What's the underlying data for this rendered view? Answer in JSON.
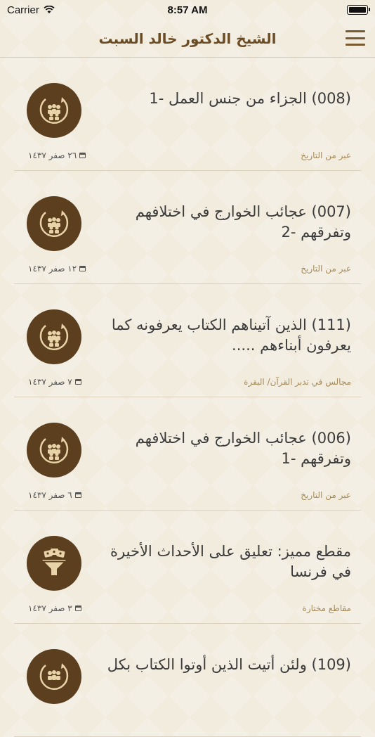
{
  "status": {
    "carrier": "Carrier",
    "time": "8:57 AM"
  },
  "header": {
    "title": "الشيخ الدكتور خالد السبت"
  },
  "items": [
    {
      "title": "(008) الجزاء من جنس العمل -1",
      "category": "عبر من التاريخ",
      "date": "٢٦ صفر ١٤٣٧",
      "icon": "audience-cycle-icon"
    },
    {
      "title": "(007) عجائب الخوارج في اختلافهم وتفرقهم -2",
      "category": "عبر من التاريخ",
      "date": "١٢ صفر ١٤٣٧",
      "icon": "audience-cycle-icon"
    },
    {
      "title": "(111) الذين آتيناهم الكتاب يعرفونه كما يعرفون أبناءهم .....",
      "category": "مجالس في تدبر القرآن/ البقرة",
      "date": "٧ صفر ١٤٣٧",
      "icon": "audience-cycle-icon"
    },
    {
      "title": "(006) عجائب الخوارج في اختلافهم وتفرقهم -1",
      "category": "عبر من التاريخ",
      "date": "٦ صفر ١٤٣٧",
      "icon": "audience-cycle-icon"
    },
    {
      "title": "مقطع مميز: تعليق على الأحداث الأخيرة في فرنسا",
      "category": "مقاطع مختارة",
      "date": "٣ صفر ١٤٣٧",
      "icon": "funnel-clips-icon"
    },
    {
      "title": "(109) ولئن أتيت الذين أوتوا الكتاب بكل",
      "category": "",
      "date": "",
      "icon": "audience-cycle-icon"
    }
  ],
  "colors": {
    "accent": "#5b3f1f",
    "title": "#6a4c25",
    "category": "#a58a58"
  }
}
